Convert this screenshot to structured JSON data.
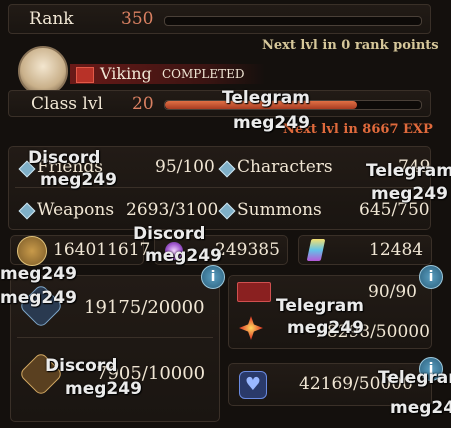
{
  "rank": {
    "label": "Rank",
    "value": "350",
    "progress": 0,
    "next": "Next lvl in 0 rank points"
  },
  "class_card": {
    "job": "Viking",
    "status": "COMPLETED"
  },
  "class_lvl": {
    "label": "Class lvl",
    "value": "20",
    "progress": 0.75,
    "next": "Next lvl in 8667 EXP"
  },
  "stats": {
    "friends": {
      "label": "Friends",
      "value": "95/100"
    },
    "characters": {
      "label": "Characters",
      "value": "749"
    },
    "weapons": {
      "label": "Weapons",
      "value": "2693/3100"
    },
    "summons": {
      "label": "Summons",
      "value": "645/750"
    }
  },
  "currency": {
    "rupies": "164011617",
    "crystals": "249385",
    "gems": "12484"
  },
  "panel_left": {
    "item1": "19175/20000",
    "item2": "7905/10000"
  },
  "panel_right_top": {
    "tickets": "90/90",
    "shards": "28298/50000"
  },
  "panel_right_bottom": {
    "hearts": "42169/50000"
  },
  "info_glyph": "i",
  "watermarks": {
    "telegram": "Telegram",
    "discord": "Discord",
    "handle": "meg249"
  },
  "colors": {
    "accent": "#e06a3c",
    "gold": "#d6c79a",
    "bar": "#c24a2a"
  }
}
